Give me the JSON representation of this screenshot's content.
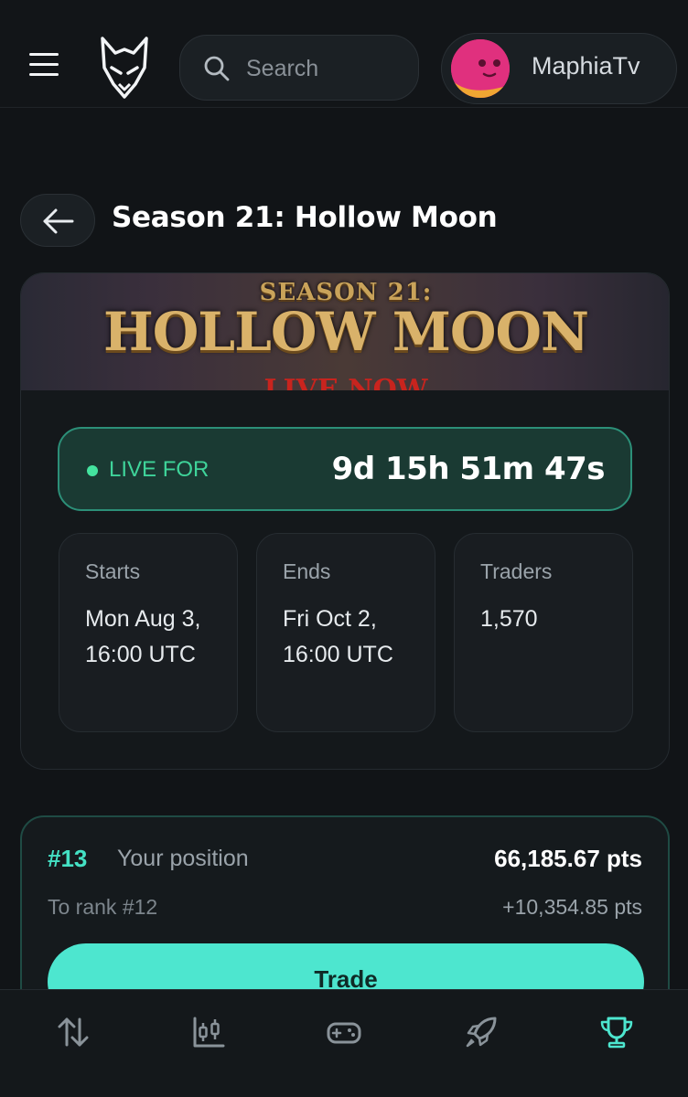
{
  "header": {
    "search_placeholder": "Search",
    "username": "MaphiaTv",
    "logo_icon": "fox-logo-icon",
    "menu_icon": "hamburger-menu-icon",
    "search_icon": "search-icon"
  },
  "page": {
    "title": "Season 21: Hollow Moon",
    "back_icon": "arrow-left-icon"
  },
  "banner": {
    "subtitle": "SEASON 21:",
    "title": "HOLLOW MOON",
    "status": "LIVE NOW"
  },
  "live": {
    "label": "LIVE FOR",
    "timer": "9d 15h 51m 47s"
  },
  "info": {
    "starts_label": "Starts",
    "starts_value": "Mon Aug 3, 16:00 UTC",
    "ends_label": "Ends",
    "ends_value": "Fri Oct 2, 16:00 UTC",
    "traders_label": "Traders",
    "traders_value": "1,570"
  },
  "position": {
    "rank": "#13",
    "label": "Your position",
    "points": "66,185.67 pts",
    "next_rank": "To rank #12",
    "points_needed": "+10,354.85 pts",
    "trade_label": "Trade"
  },
  "nav": {
    "items": [
      {
        "icon": "swap-arrows-icon",
        "active": false
      },
      {
        "icon": "candlestick-chart-icon",
        "active": false
      },
      {
        "icon": "gamepad-icon",
        "active": false
      },
      {
        "icon": "rocket-icon",
        "active": false
      },
      {
        "icon": "trophy-icon",
        "active": true
      }
    ]
  },
  "colors": {
    "background": "#111417",
    "accent": "#4de6cf",
    "live_green": "#3fd49a",
    "avatar": "#e0307e"
  }
}
